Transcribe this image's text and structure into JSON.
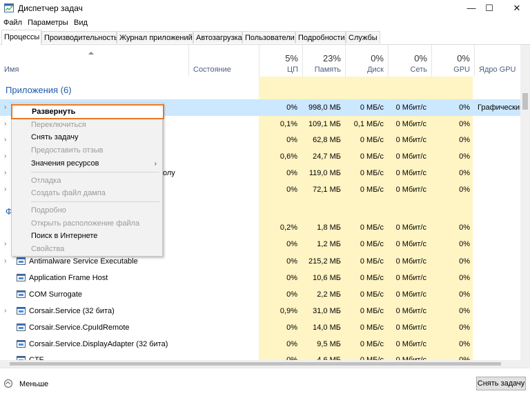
{
  "window": {
    "title": "Диспетчер задач",
    "minimize": "—",
    "maximize": "☐",
    "close": "✕"
  },
  "menu": [
    "Файл",
    "Параметры",
    "Вид"
  ],
  "tabs": [
    "Процессы",
    "Производительность",
    "Журнал приложений",
    "Автозагрузка",
    "Пользователи",
    "Подробности",
    "Службы"
  ],
  "columns": {
    "name": "Имя",
    "status": "Состояние",
    "cpu": {
      "pct": "5%",
      "label": "ЦП"
    },
    "memory": {
      "pct": "23%",
      "label": "Память"
    },
    "disk": {
      "pct": "0%",
      "label": "Диск"
    },
    "network": {
      "pct": "0%",
      "label": "Сеть"
    },
    "gpu": {
      "pct": "0%",
      "label": "GPU"
    },
    "gpu_engine": "Ядро GPU"
  },
  "groups": {
    "apps": "Приложения (6)",
    "background": "Ф"
  },
  "app_rows": [
    {
      "name": "",
      "cpu": "0%",
      "mem": "998,0 МБ",
      "disk": "0 МБ/с",
      "net": "0 Мбит/с",
      "gpu": "0%",
      "engine": "Графический"
    },
    {
      "name": "",
      "cpu": "0,1%",
      "mem": "109,1 МБ",
      "disk": "0,1 МБ/с",
      "net": "0 Мбит/с",
      "gpu": "0%",
      "engine": ""
    },
    {
      "name": "",
      "cpu": "0%",
      "mem": "62,8 МБ",
      "disk": "0 МБ/с",
      "net": "0 Мбит/с",
      "gpu": "0%",
      "engine": ""
    },
    {
      "name": "",
      "cpu": "0,6%",
      "mem": "24,7 МБ",
      "disk": "0 МБ/с",
      "net": "0 Мбит/с",
      "gpu": "0%",
      "engine": ""
    },
    {
      "name": "олу",
      "cpu": "0%",
      "mem": "119,0 МБ",
      "disk": "0 МБ/с",
      "net": "0 Мбит/с",
      "gpu": "0%",
      "engine": ""
    },
    {
      "name": "",
      "cpu": "0%",
      "mem": "72,1 МБ",
      "disk": "0 МБ/с",
      "net": "0 Мбит/с",
      "gpu": "0%",
      "engine": ""
    }
  ],
  "bg_rows": [
    {
      "name": "",
      "cpu": "0,2%",
      "mem": "1,8 МБ",
      "disk": "0 МБ/с",
      "net": "0 Мбит/с",
      "gpu": "0%"
    },
    {
      "name": "",
      "cpu": "0%",
      "mem": "1,2 МБ",
      "disk": "0 МБ/с",
      "net": "0 Мбит/с",
      "gpu": "0%"
    },
    {
      "name": "Antimalware Service Executable",
      "cpu": "0%",
      "mem": "215,2 МБ",
      "disk": "0 МБ/с",
      "net": "0 Мбит/с",
      "gpu": "0%"
    },
    {
      "name": "Application Frame Host",
      "cpu": "0%",
      "mem": "10,6 МБ",
      "disk": "0 МБ/с",
      "net": "0 Мбит/с",
      "gpu": "0%"
    },
    {
      "name": "COM Surrogate",
      "cpu": "0%",
      "mem": "2,2 МБ",
      "disk": "0 МБ/с",
      "net": "0 Мбит/с",
      "gpu": "0%"
    },
    {
      "name": "Corsair.Service (32 бита)",
      "cpu": "0,9%",
      "mem": "31,0 МБ",
      "disk": "0 МБ/с",
      "net": "0 Мбит/с",
      "gpu": "0%"
    },
    {
      "name": "Corsair.Service.CpuIdRemote",
      "cpu": "0%",
      "mem": "14,0 МБ",
      "disk": "0 МБ/с",
      "net": "0 Мбит/с",
      "gpu": "0%"
    },
    {
      "name": "Corsair.Service.DisplayAdapter (32 бита)",
      "cpu": "0%",
      "mem": "9,5 МБ",
      "disk": "0 МБ/с",
      "net": "0 Мбит/с",
      "gpu": "0%"
    },
    {
      "name": "CTF",
      "cpu": "0%",
      "mem": "4,6 МБ",
      "disk": "0 МБ/с",
      "net": "0 Мбит/с",
      "gpu": "0%"
    }
  ],
  "context_menu": {
    "expand": "Развернуть",
    "switch_to": "Переключиться",
    "end_task": "Снять задачу",
    "feedback": "Предоставить отзыв",
    "resource_values": "Значения ресурсов",
    "debug": "Отладка",
    "dump": "Создать файл дампа",
    "details": "Подробно",
    "open_location": "Открыть расположение файла",
    "search_online": "Поиск в Интернете",
    "properties": "Свойства"
  },
  "footer": {
    "less": "Меньше",
    "end_task": "Снять задачу"
  },
  "colors": {
    "accent": "#1e5aa8",
    "highlight_border": "#e87722",
    "usage_fill": "#fff4c4",
    "selected_row": "#cce8ff"
  }
}
